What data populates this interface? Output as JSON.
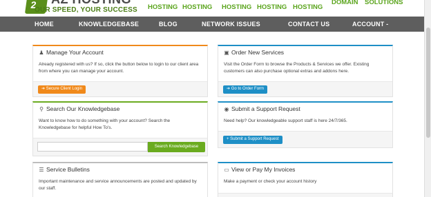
{
  "header": {
    "brand": "AZ HOSTING",
    "brand_mark": "2",
    "tagline": "OUR SPEED, YOUR SUCCESS",
    "top_links": [
      "HOSTING",
      "HOSTING",
      "HOSTING",
      "HOSTING",
      "HOSTING",
      "DOMAIN",
      "SOLUTIONS"
    ]
  },
  "nav": {
    "home": "HOME",
    "knowledgebase": "KNOWLEDGEBASE",
    "blog": "BLOG",
    "network": "NETWORK ISSUES",
    "contact": "CONTACT US",
    "account": "ACCOUNT -"
  },
  "panels": {
    "manage": {
      "title": "Manage Your Account",
      "icon": "user-icon",
      "body": "Already registered with us? If so, click the button below to login to our client area from where you can manage your account.",
      "button": "➔ Secure Client Login"
    },
    "order": {
      "title": "Order New Services",
      "icon": "cube-icon",
      "body": "Visit the Order Form to browse the Products & Services we offer. Existing customers can also purchase optional extras and addons here.",
      "button": "➔ Go to Order Form"
    },
    "search": {
      "title": "Search Our Knowledgebase",
      "icon": "search-icon",
      "body": "Want to know how to do something with your account? Search the Knowledgebase for helpful How To's.",
      "input_placeholder": "",
      "button": "Search Knowledgebase"
    },
    "support": {
      "title": "Submit a Support Request",
      "icon": "comment-icon",
      "body": "Need help? Our knowledgeable support staff is here 24/7/365.",
      "button": "+ Submit a Support Request"
    },
    "bulletins": {
      "title": "Service Bulletins",
      "icon": "list-icon",
      "body": "Important maintenance and service announcements are posted and updated by our staff."
    },
    "invoices": {
      "title": "View or Pay My Invoices",
      "icon": "credit-card-icon",
      "body": "Make a payment or check your account history"
    }
  },
  "colors": {
    "accent_orange": "#f0891a",
    "accent_blue": "#1e8fc6",
    "accent_green": "#6aab1f",
    "nav_bg": "#5e5e5e"
  }
}
